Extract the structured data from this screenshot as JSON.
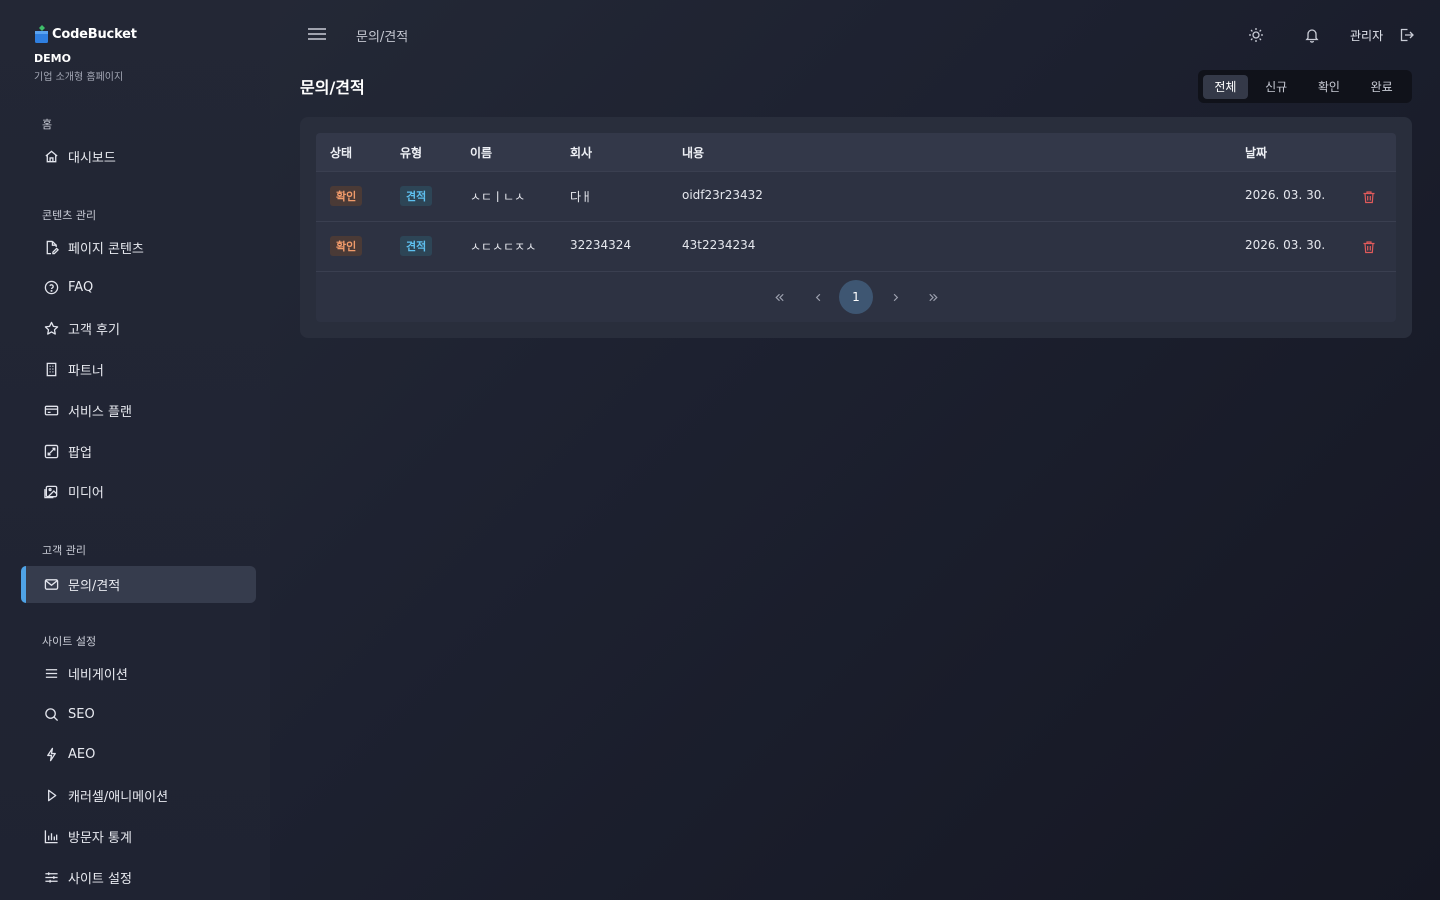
{
  "brand": {
    "name": "CodeBucket",
    "edition": "DEMO",
    "description": "기업 소개형 홈페이지"
  },
  "sidebar": {
    "sections": [
      {
        "label": "홈",
        "items": [
          {
            "label": "대시보드",
            "icon": "home-icon"
          }
        ]
      },
      {
        "label": "콘텐츠 관리",
        "items": [
          {
            "label": "페이지 콘텐츠",
            "icon": "file-edit-icon"
          },
          {
            "label": "FAQ",
            "icon": "question-circle-icon"
          },
          {
            "label": "고객 후기",
            "icon": "star-icon"
          },
          {
            "label": "파트너",
            "icon": "building-icon"
          },
          {
            "label": "서비스 플랜",
            "icon": "credit-card-icon"
          },
          {
            "label": "팝업",
            "icon": "popup-icon"
          },
          {
            "label": "미디어",
            "icon": "image-icon"
          }
        ]
      },
      {
        "label": "고객 관리",
        "items": [
          {
            "label": "문의/견적",
            "icon": "mail-icon",
            "active": true
          }
        ]
      },
      {
        "label": "사이트 설정",
        "items": [
          {
            "label": "네비게이션",
            "icon": "menu-icon"
          },
          {
            "label": "SEO",
            "icon": "search-icon"
          },
          {
            "label": "AEO",
            "icon": "bolt-icon"
          },
          {
            "label": "캐러셀/애니메이션",
            "icon": "play-icon"
          },
          {
            "label": "방문자 통계",
            "icon": "bar-chart-icon"
          },
          {
            "label": "사이트 설정",
            "icon": "sliders-icon"
          }
        ]
      }
    ]
  },
  "topbar": {
    "breadcrumb": "문의/견적",
    "user": "관리자",
    "icons": [
      "menu-icon",
      "sun-icon",
      "bell-icon",
      "logout-icon"
    ]
  },
  "page": {
    "title": "문의/견적",
    "filters": [
      {
        "label": "전체",
        "active": true
      },
      {
        "label": "신규",
        "active": false
      },
      {
        "label": "확인",
        "active": false
      },
      {
        "label": "완료",
        "active": false
      }
    ]
  },
  "table": {
    "columns": [
      "상태",
      "유형",
      "이름",
      "회사",
      "내용",
      "날짜"
    ],
    "rows": [
      {
        "status": "확인",
        "type": "견적",
        "name": "ㅅㄷㅣㄴㅅ",
        "company": "다ㅐ",
        "content": "oidf23r23432",
        "date": "2026. 03. 30."
      },
      {
        "status": "확인",
        "type": "견적",
        "name": "ㅅㄷㅅㄷㅈㅅ",
        "company": "32234324",
        "content": "43t2234234",
        "date": "2026. 03. 30."
      }
    ],
    "pagination": {
      "current": "1",
      "first": "«",
      "prev": "‹",
      "next": "›",
      "last": "»"
    }
  },
  "colors": {
    "accent": "#4fa3e6",
    "status_confirm": "#f09a6a",
    "type_quote": "#5ec0ef",
    "danger": "#e05a5a"
  }
}
